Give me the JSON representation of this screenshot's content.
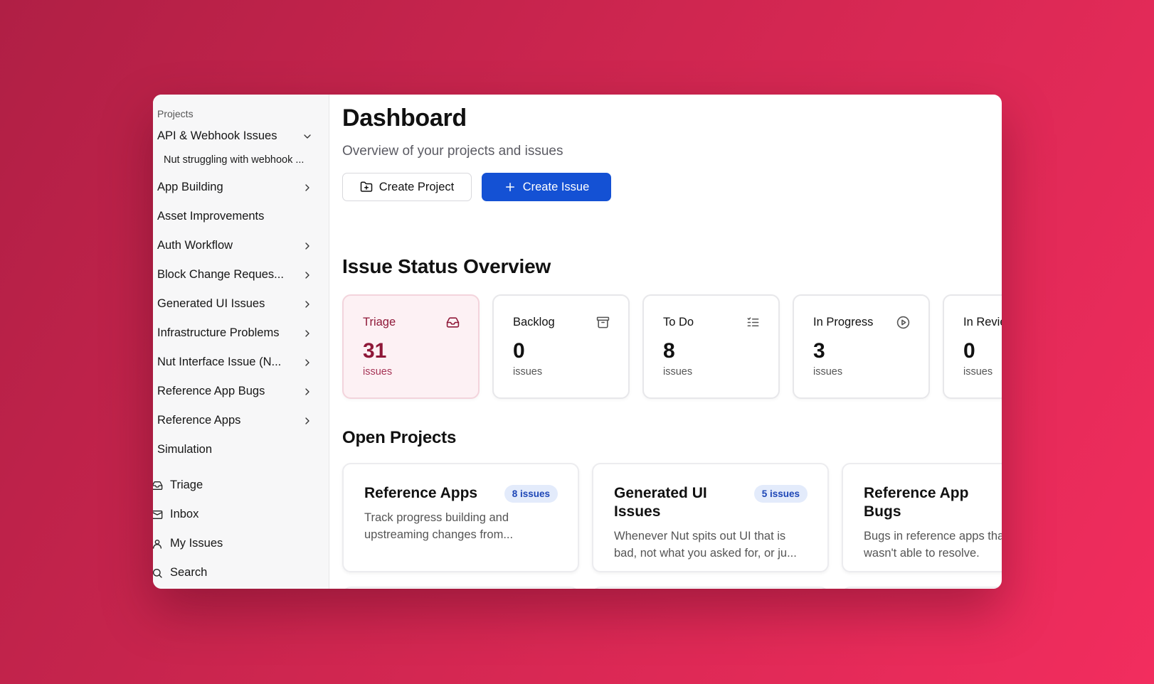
{
  "sidebar": {
    "heading": "Projects",
    "projects": [
      {
        "label": "API & Webhook Issues",
        "chevron": "down",
        "sub": [
          "Nut struggling with webhook ..."
        ]
      },
      {
        "label": "App Building",
        "chevron": "right"
      },
      {
        "label": "Asset Improvements",
        "chevron": "none"
      },
      {
        "label": "Auth Workflow",
        "chevron": "right"
      },
      {
        "label": "Block Change Reques...",
        "chevron": "right"
      },
      {
        "label": "Generated UI Issues",
        "chevron": "right"
      },
      {
        "label": "Infrastructure Problems",
        "chevron": "right"
      },
      {
        "label": "Nut Interface Issue (N...",
        "chevron": "right"
      },
      {
        "label": "Reference App Bugs",
        "chevron": "right"
      },
      {
        "label": "Reference Apps",
        "chevron": "right"
      },
      {
        "label": "Simulation",
        "chevron": "none"
      }
    ],
    "nav": [
      {
        "label": "Triage",
        "icon": "inbox-tray-icon"
      },
      {
        "label": "Inbox",
        "icon": "mail-icon"
      },
      {
        "label": "My Issues",
        "icon": "user-icon"
      },
      {
        "label": "Search",
        "icon": "search-icon"
      }
    ]
  },
  "main": {
    "title": "Dashboard",
    "subtitle": "Overview of your projects and issues",
    "create_project_label": "Create Project",
    "create_issue_label": "Create Issue",
    "status_title": "Issue Status Overview",
    "statuses": [
      {
        "name": "Triage",
        "count": "31",
        "unit": "issues",
        "icon": "inbox-tray-icon",
        "active": true
      },
      {
        "name": "Backlog",
        "count": "0",
        "unit": "issues",
        "icon": "archive-icon",
        "active": false
      },
      {
        "name": "To Do",
        "count": "8",
        "unit": "issues",
        "icon": "checklist-icon",
        "active": false
      },
      {
        "name": "In Progress",
        "count": "3",
        "unit": "issues",
        "icon": "play-circle-icon",
        "active": false
      },
      {
        "name": "In Review",
        "count": "0",
        "unit": "issues",
        "icon": "eye-icon",
        "active": false
      }
    ],
    "projects_title": "Open Projects",
    "projects": [
      {
        "title": "Reference Apps",
        "badge": "8 issues",
        "desc": "Track progress building and upstreaming changes from..."
      },
      {
        "title": "Generated UI Issues",
        "badge": "5 issues",
        "desc": "Whenever Nut spits out UI that is bad, not what you asked for, or ju..."
      },
      {
        "title": "Reference App Bugs",
        "badge": "",
        "desc": "Bugs in reference apps that Nut wasn't able to resolve."
      }
    ]
  },
  "colors": {
    "primary": "#1451d4",
    "triage_accent": "#8f1838",
    "badge_bg": "#e3ebfb",
    "background_start": "#b01f45",
    "background_end": "#f22d5e"
  }
}
